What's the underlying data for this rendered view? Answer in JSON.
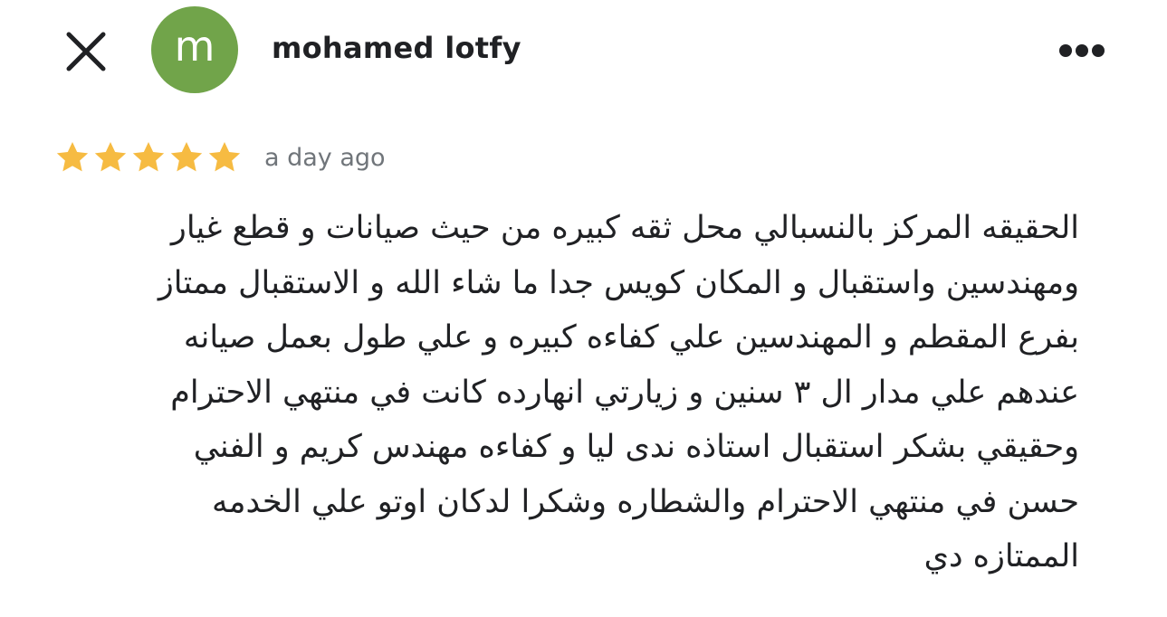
{
  "header": {
    "close_icon": "close-icon",
    "avatar_initial": "m",
    "avatar_color": "#71a44a",
    "author_name": "mohamed lotfy",
    "more_icon": "more-horizontal-icon"
  },
  "review": {
    "rating": 5,
    "rating_max": 5,
    "star_color": "#f6bb42",
    "date": "a day ago",
    "lines": [
      "الحقيقه المركز بالنسبالي محل ثقه كبيره من حيث صيانات و قطع غيار",
      "ومهندسين واستقبال و المكان كويس جدا ما شاء الله و الاستقبال ممتاز",
      "بفرع المقطم و المهندسين علي كفاءه كبيره و علي طول بعمل صيانه",
      "عندهم علي مدار ال ٣ سنين و زيارتي انهارده كانت في منتهي الاحترام",
      "وحقيقي بشكر استقبال استاذه ندى ليا و كفاءه مهندس كريم و الفني",
      "حسن في منتهي الاحترام والشطاره وشكرا لدكان اوتو  علي الخدمه",
      "الممتازه دي"
    ]
  }
}
